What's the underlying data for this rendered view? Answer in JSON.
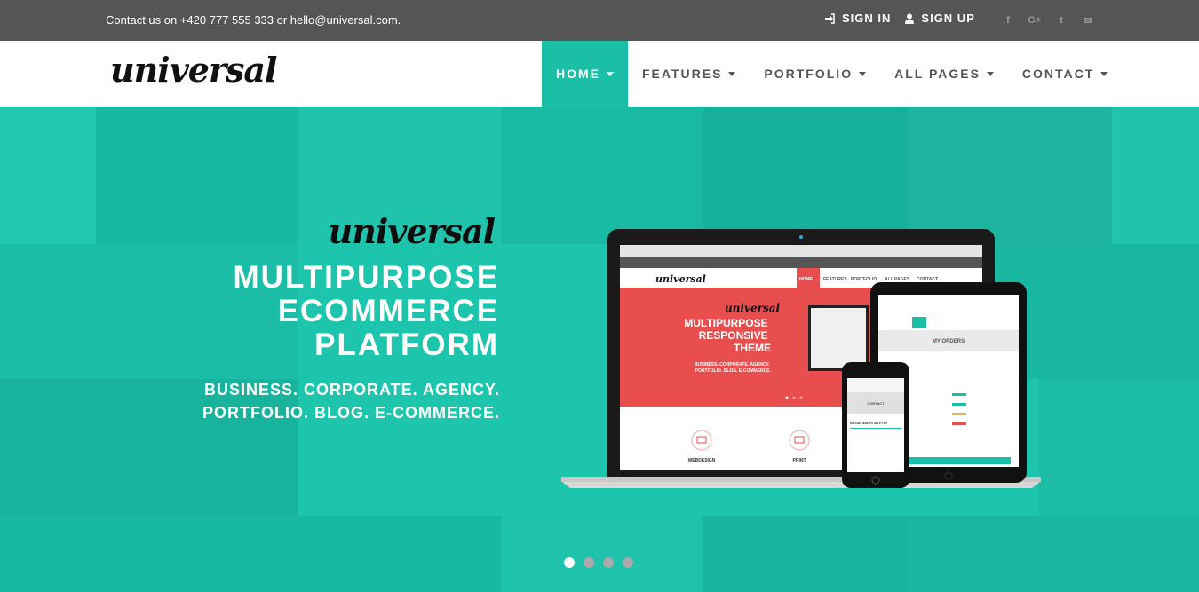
{
  "topbar": {
    "contact": "Contact us on +420 777 555 333 or hello@universal.com.",
    "signin": "SIGN IN",
    "signup": "SIGN UP",
    "social": [
      "f",
      "G+",
      "t",
      "✉"
    ]
  },
  "brand": {
    "logo": "universal"
  },
  "nav": {
    "items": [
      {
        "label": "HOME"
      },
      {
        "label": "FEATURES"
      },
      {
        "label": "PORTFOLIO"
      },
      {
        "label": "ALL PAGES"
      },
      {
        "label": "CONTACT"
      }
    ]
  },
  "hero": {
    "logo": "universal",
    "title_lines": [
      "MULTIPURPOSE",
      "ECOMMERCE",
      "PLATFORM"
    ],
    "subtitle_lines": [
      "BUSINESS. CORPORATE. AGENCY.",
      "PORTFOLIO. BLOG. E-COMMERCE."
    ],
    "slide_count": 4,
    "active_slide": 1
  },
  "mockup": {
    "laptop": {
      "logo": "universal",
      "nav": [
        "HOME",
        "FEATURES",
        "PORTFOLIO",
        "ALL PAGES",
        "CONTACT"
      ],
      "hero_logo": "universal",
      "title_lines": [
        "MULTIPURPOSE",
        "RESPONSIVE",
        "THEME"
      ],
      "sub_lines": [
        "BUSINESS. CORPORATE. AGENCY.",
        "PORTFOLIO. BLOG. E-COMMERCE."
      ],
      "features": [
        "WEBDESIGN",
        "PRINT"
      ]
    },
    "tablet": {
      "heading": "MY ORDERS"
    },
    "phone": {
      "heading": "CONTACT",
      "subheading": "WE ARE HERE TO HELP YOU"
    }
  },
  "colors": {
    "accent": "#1bbfa6",
    "topbar": "#555555",
    "mockup_accent": "#e94e4e"
  }
}
